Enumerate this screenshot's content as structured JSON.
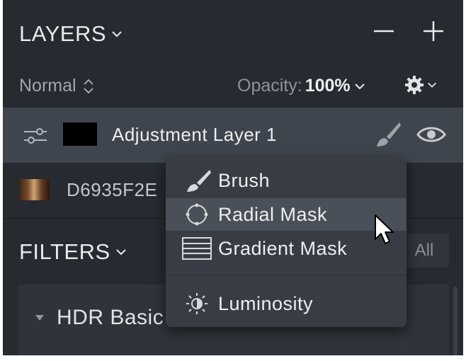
{
  "layers": {
    "title": "LAYERS",
    "blend_mode": "Normal",
    "opacity_label": "Opacity:",
    "opacity_value": "100%",
    "items": [
      {
        "name": "Adjustment Layer 1",
        "selected": true
      },
      {
        "name": "D6935F2E"
      }
    ]
  },
  "filters": {
    "title": "FILTERS",
    "all_label": "All",
    "first_filter": "HDR Basic"
  },
  "context_menu": {
    "items": [
      {
        "label": "Brush",
        "icon": "brush-icon"
      },
      {
        "label": "Radial Mask",
        "icon": "radial-mask-icon",
        "hovered": true
      },
      {
        "label": "Gradient Mask",
        "icon": "gradient-mask-icon"
      },
      {
        "label": "Luminosity",
        "icon": "luminosity-icon"
      }
    ]
  },
  "colors": {
    "panel_bg": "#262a31",
    "selected_row": "#3f454e",
    "menu_bg": "#383d45",
    "menu_hover": "#4a5059",
    "text_primary": "#eceef0"
  }
}
